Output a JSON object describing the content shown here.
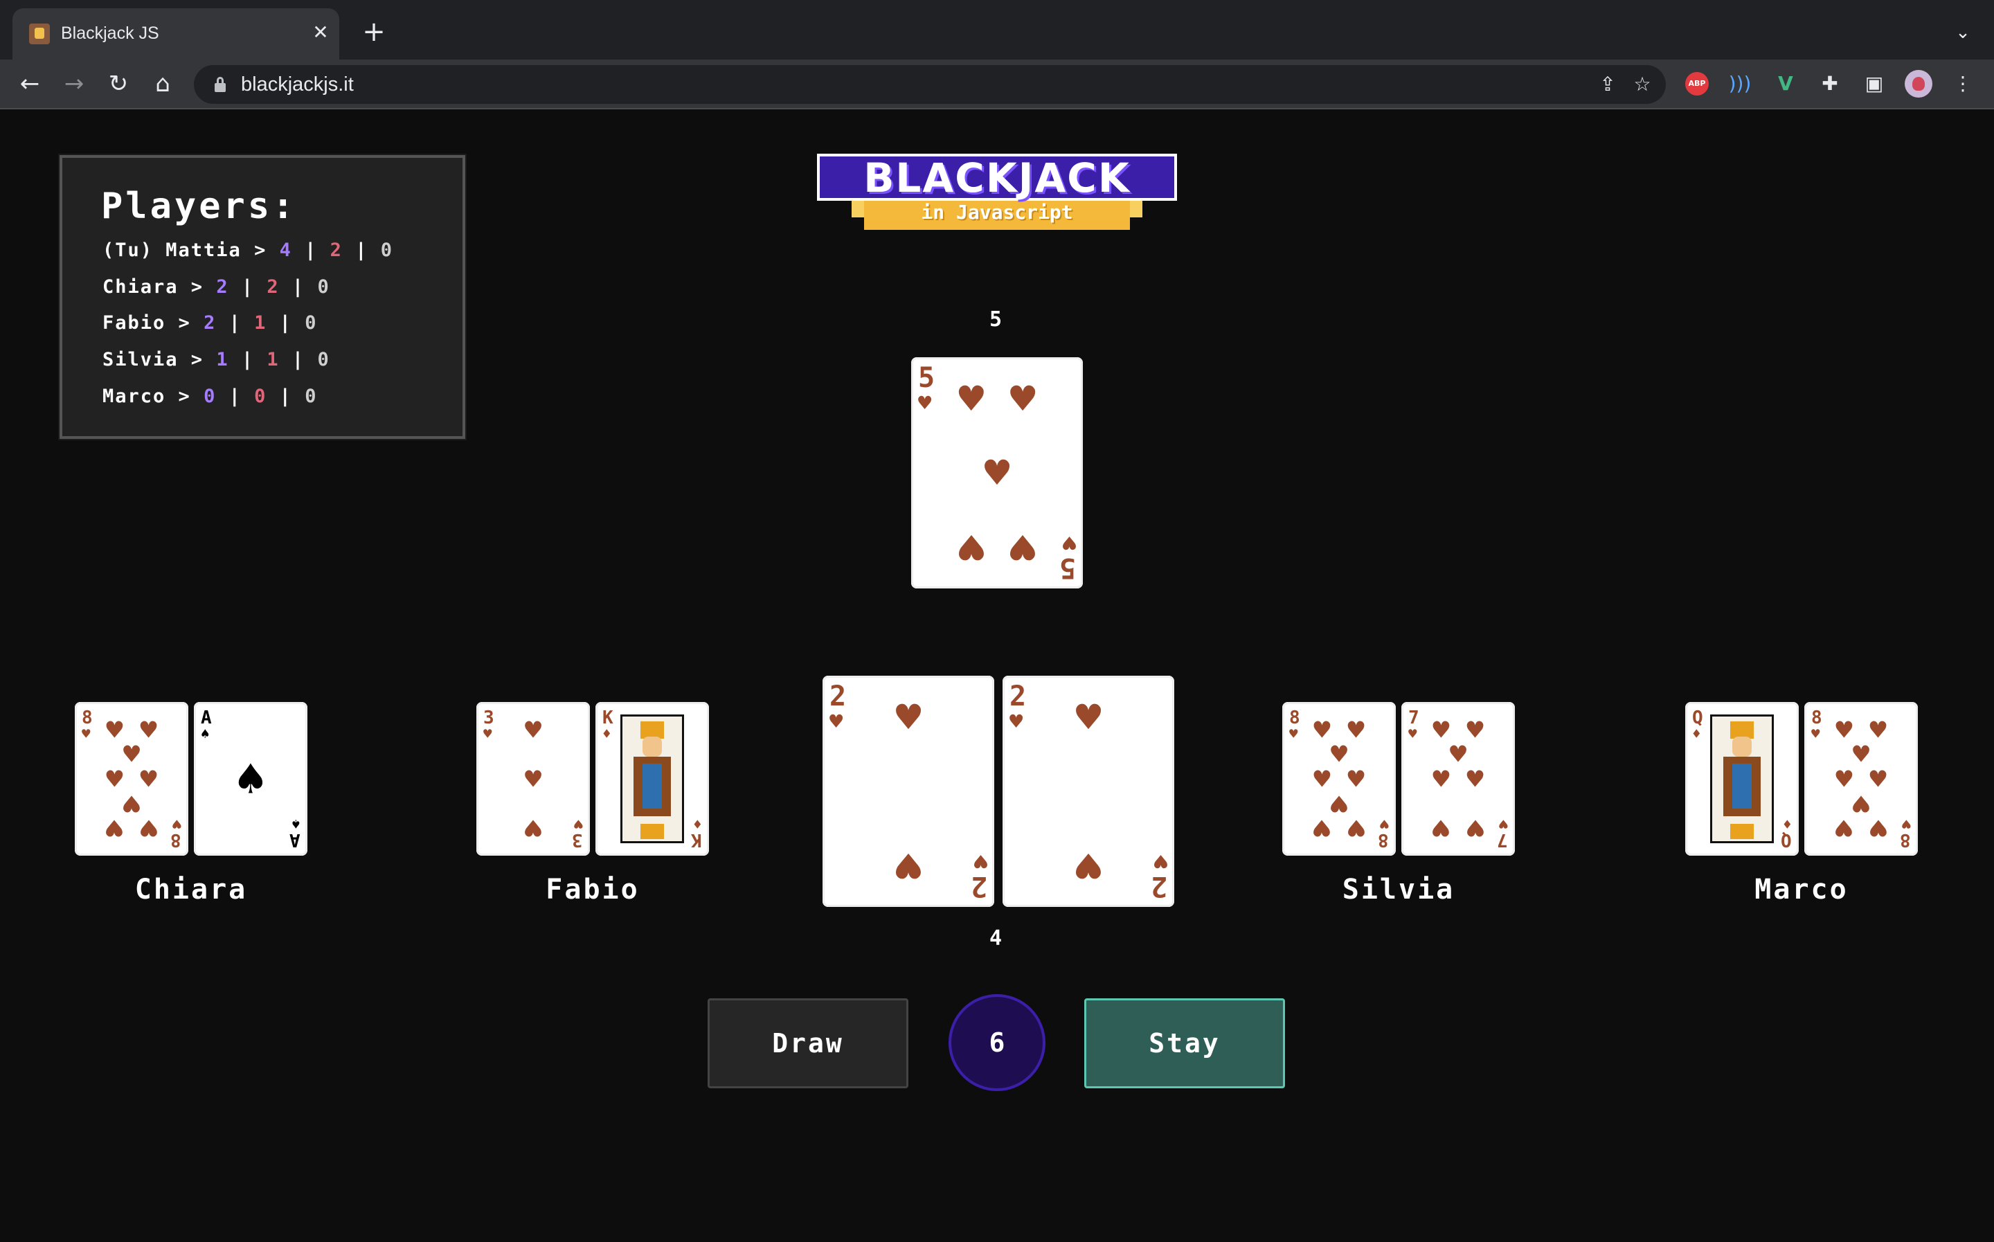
{
  "browser": {
    "tab_title": "Blackjack JS",
    "url": "blackjackjs.it",
    "extensions": {
      "abp_label": "ABP"
    }
  },
  "players_panel": {
    "title": "Players:",
    "players": [
      {
        "name": "(Tu) Mattia",
        "wins": "4",
        "losses": "2",
        "draws": "0"
      },
      {
        "name": "Chiara",
        "wins": "2",
        "losses": "2",
        "draws": "0"
      },
      {
        "name": "Fabio",
        "wins": "2",
        "losses": "1",
        "draws": "0"
      },
      {
        "name": "Silvia",
        "wins": "1",
        "losses": "1",
        "draws": "0"
      },
      {
        "name": "Marco",
        "wins": "0",
        "losses": "0",
        "draws": "0"
      }
    ]
  },
  "logo": {
    "title": "BLACKJACK",
    "subtitle": "in Javascript"
  },
  "dealer": {
    "score": "5",
    "cards": [
      {
        "rank": "5",
        "suit": "hearts"
      }
    ]
  },
  "you": {
    "score": "4",
    "cards": [
      {
        "rank": "2",
        "suit": "hearts"
      },
      {
        "rank": "2",
        "suit": "hearts"
      }
    ]
  },
  "opponents": [
    {
      "name": "Chiara",
      "cards": [
        {
          "rank": "8",
          "suit": "hearts"
        },
        {
          "rank": "A",
          "suit": "spades"
        }
      ]
    },
    {
      "name": "Fabio",
      "cards": [
        {
          "rank": "3",
          "suit": "hearts"
        },
        {
          "rank": "K",
          "suit": "diamonds"
        }
      ]
    },
    {
      "name": "Silvia",
      "cards": [
        {
          "rank": "8",
          "suit": "hearts"
        },
        {
          "rank": "7",
          "suit": "hearts"
        }
      ]
    },
    {
      "name": "Marco",
      "cards": [
        {
          "rank": "Q",
          "suit": "diamonds"
        },
        {
          "rank": "8",
          "suit": "hearts"
        }
      ]
    }
  ],
  "controls": {
    "draw_label": "Draw",
    "counter": "6",
    "stay_label": "Stay"
  }
}
